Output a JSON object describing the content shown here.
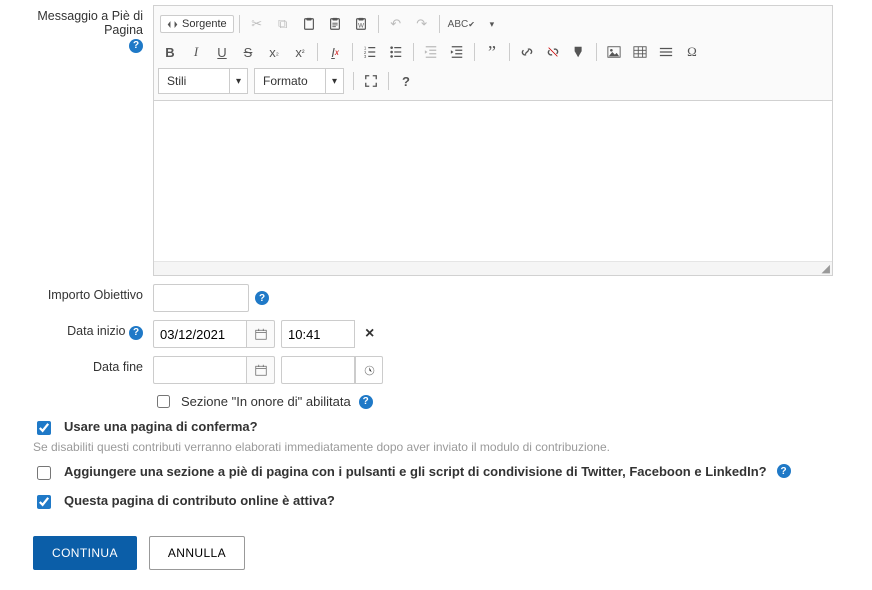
{
  "labels": {
    "footerMessage": "Messaggio a Piè di Pagina",
    "goalAmount": "Importo Obiettivo",
    "startDate": "Data inizio",
    "endDate": "Data fine",
    "honorSection": "Sezione \"In onore di\" abilitata"
  },
  "editor": {
    "sourceLabel": "Sorgente",
    "styles": "Stili",
    "format": "Formato"
  },
  "fields": {
    "goalAmount": "",
    "startDate": "03/12/2021",
    "startTime": "10:41",
    "endDate": "",
    "endTime": ""
  },
  "checks": {
    "honor": false,
    "confirmPage": {
      "checked": true,
      "label": "Usare una pagina di conferma?"
    },
    "confirmHint": "Se disabiliti questi contributi verranno elaborati immediatamente dopo aver inviato il modulo di contribuzione.",
    "shareSection": {
      "checked": false,
      "label": "Aggiungere una sezione a piè di pagina con i pulsanti e gli script di condivisione di Twitter, Faceboon e LinkedIn?"
    },
    "active": {
      "checked": true,
      "label": "Questa pagina di contributo online è attiva?"
    }
  },
  "buttons": {
    "continue": "Continua",
    "cancel": "Annulla"
  }
}
